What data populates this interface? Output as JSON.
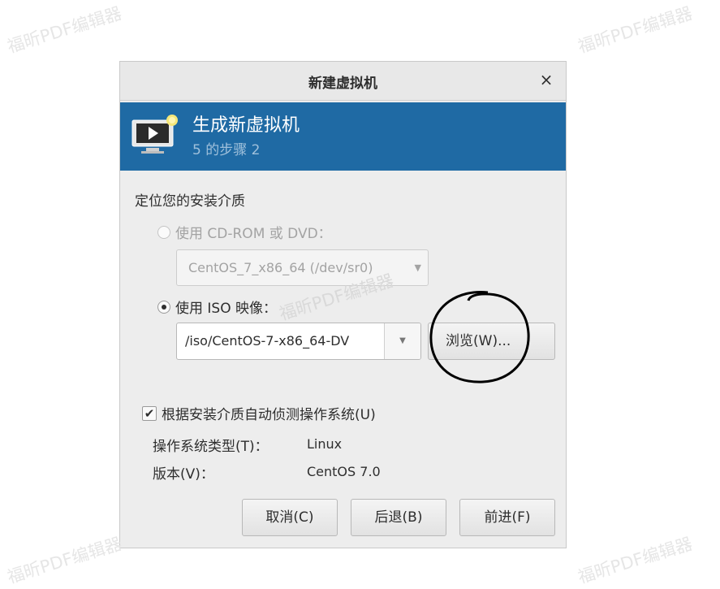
{
  "watermark": "福昕PDF编辑器",
  "dialog": {
    "title": "新建虚拟机",
    "close_icon": "×"
  },
  "banner": {
    "icon": "monitor-play-icon",
    "title": "生成新虚拟机",
    "step": "5 的步骤 2",
    "color": "#1f6aa4"
  },
  "install_media": {
    "section_label": "定位您的安装介质",
    "cdrom_option": {
      "label": "使用 CD-ROM 或 DVD：",
      "checked": false,
      "enabled": false,
      "selected_value": "CentOS_7_x86_64 (/dev/sr0)"
    },
    "iso_option": {
      "label": "使用 ISO 映像：",
      "checked": true,
      "path_value": "/iso/CentOS-7-x86_64-DV",
      "browse_label": "浏览(W)..."
    }
  },
  "os_detect": {
    "checkbox_label": "根据安装介质自动侦测操作系统(U)",
    "checked": true,
    "os_type_label": "操作系统类型(T)：",
    "os_type_value": "Linux",
    "version_label": "版本(V)：",
    "version_value": "CentOS 7.0"
  },
  "buttons": {
    "cancel": "取消(C)",
    "back": "后退(B)",
    "forward": "前进(F)"
  }
}
